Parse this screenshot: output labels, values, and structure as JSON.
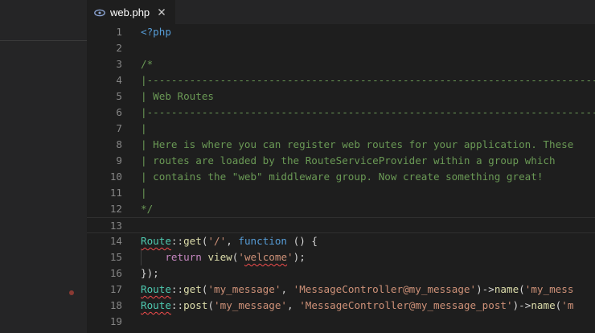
{
  "tab": {
    "filename": "web.php",
    "icon": "php-file-icon",
    "close_glyph": "✕"
  },
  "editor": {
    "lines": [
      {
        "n": "1",
        "tokens": [
          {
            "t": "<?php",
            "c": "php"
          }
        ]
      },
      {
        "n": "2",
        "tokens": []
      },
      {
        "n": "3",
        "tokens": [
          {
            "t": "/*",
            "c": "comment"
          }
        ]
      },
      {
        "n": "4",
        "tokens": [
          {
            "t": "|--------------------------------------------------------------------------",
            "c": "comment"
          }
        ]
      },
      {
        "n": "5",
        "tokens": [
          {
            "t": "| Web Routes",
            "c": "comment"
          }
        ]
      },
      {
        "n": "6",
        "tokens": [
          {
            "t": "|--------------------------------------------------------------------------",
            "c": "comment"
          }
        ]
      },
      {
        "n": "7",
        "tokens": [
          {
            "t": "|",
            "c": "comment"
          }
        ]
      },
      {
        "n": "8",
        "tokens": [
          {
            "t": "| Here is where you can register web routes for your application. These",
            "c": "comment"
          }
        ]
      },
      {
        "n": "9",
        "tokens": [
          {
            "t": "| routes are loaded by the RouteServiceProvider within a group which",
            "c": "comment"
          }
        ]
      },
      {
        "n": "10",
        "tokens": [
          {
            "t": "| contains the \"web\" middleware group. Now create something great!",
            "c": "comment"
          }
        ]
      },
      {
        "n": "11",
        "tokens": [
          {
            "t": "|",
            "c": "comment"
          }
        ]
      },
      {
        "n": "12",
        "tokens": [
          {
            "t": "*/",
            "c": "comment"
          }
        ]
      },
      {
        "n": "13",
        "tokens": [],
        "current": true
      },
      {
        "n": "14",
        "tokens": [
          {
            "t": "Route",
            "c": "class",
            "squiggle": true
          },
          {
            "t": "::",
            "c": "plain"
          },
          {
            "t": "get",
            "c": "fn"
          },
          {
            "t": "(",
            "c": "plain"
          },
          {
            "t": "'/'",
            "c": "str"
          },
          {
            "t": ", ",
            "c": "plain"
          },
          {
            "t": "function",
            "c": "kw"
          },
          {
            "t": " () {",
            "c": "plain"
          }
        ]
      },
      {
        "n": "15",
        "indent": true,
        "tokens": [
          {
            "t": "    ",
            "c": "plain"
          },
          {
            "t": "return",
            "c": "ctrl"
          },
          {
            "t": " ",
            "c": "plain"
          },
          {
            "t": "view",
            "c": "fn"
          },
          {
            "t": "(",
            "c": "plain"
          },
          {
            "t": "'",
            "c": "str"
          },
          {
            "t": "welcome",
            "c": "str",
            "squiggle": true
          },
          {
            "t": "'",
            "c": "str"
          },
          {
            "t": ");",
            "c": "plain"
          }
        ]
      },
      {
        "n": "16",
        "tokens": [
          {
            "t": "});",
            "c": "plain"
          }
        ]
      },
      {
        "n": "17",
        "breakpoint": true,
        "tokens": [
          {
            "t": "Route",
            "c": "class",
            "squiggle": true
          },
          {
            "t": "::",
            "c": "plain"
          },
          {
            "t": "get",
            "c": "fn"
          },
          {
            "t": "(",
            "c": "plain"
          },
          {
            "t": "'my_message'",
            "c": "str"
          },
          {
            "t": ", ",
            "c": "plain"
          },
          {
            "t": "'MessageController@my_message'",
            "c": "str"
          },
          {
            "t": ")->",
            "c": "plain"
          },
          {
            "t": "name",
            "c": "fn"
          },
          {
            "t": "(",
            "c": "plain"
          },
          {
            "t": "'my_mess",
            "c": "str"
          }
        ]
      },
      {
        "n": "18",
        "tokens": [
          {
            "t": "Route",
            "c": "class",
            "squiggle": true
          },
          {
            "t": "::",
            "c": "plain"
          },
          {
            "t": "post",
            "c": "fn"
          },
          {
            "t": "(",
            "c": "plain"
          },
          {
            "t": "'my_message'",
            "c": "str"
          },
          {
            "t": ", ",
            "c": "plain"
          },
          {
            "t": "'MessageController@my_message_post'",
            "c": "str"
          },
          {
            "t": ")->",
            "c": "plain"
          },
          {
            "t": "name",
            "c": "fn"
          },
          {
            "t": "(",
            "c": "plain"
          },
          {
            "t": "'m",
            "c": "str"
          }
        ]
      },
      {
        "n": "19",
        "tokens": []
      }
    ]
  },
  "colors": {
    "background": "#1e1e1e",
    "sidebar": "#252526",
    "comment": "#6a9955",
    "string": "#ce9178",
    "keyword": "#569cd6",
    "class": "#4ec9b0",
    "function": "#dcdcaa",
    "control": "#c586c0",
    "error_squiggle": "#f14c4c",
    "breakpoint": "#8a3a33"
  }
}
